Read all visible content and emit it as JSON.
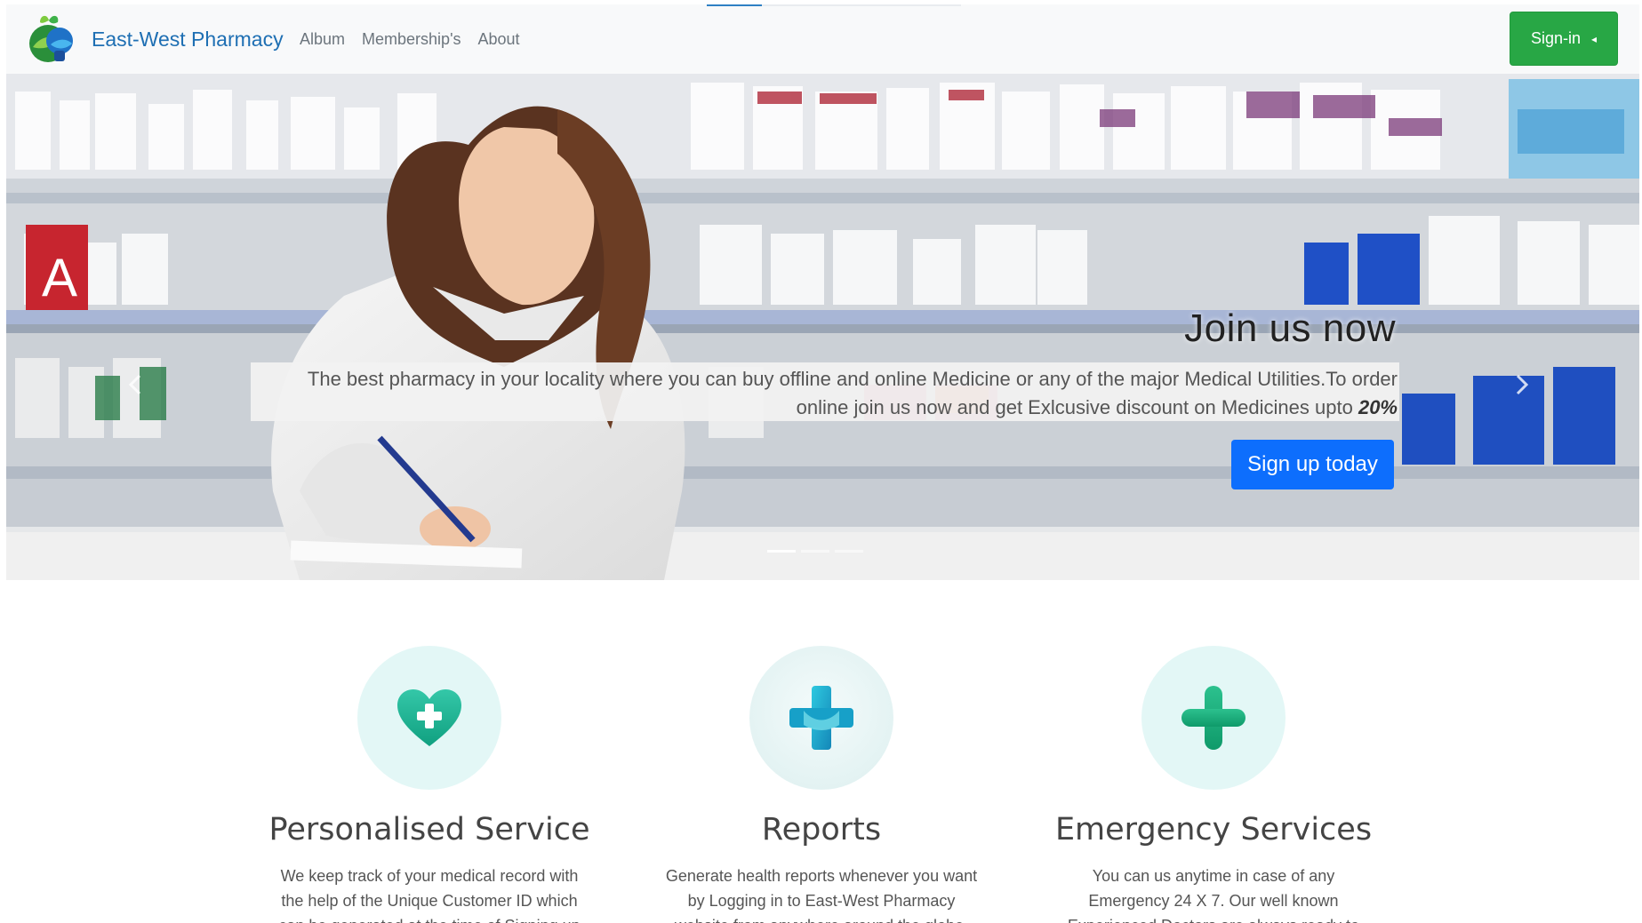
{
  "navbar": {
    "brand_name": "East-West Pharmacy",
    "links": [
      "Album",
      "Membership's",
      "About"
    ],
    "signin_label": "Sign-in",
    "signin_caret": "◂",
    "signin_color": "#28a745"
  },
  "hero": {
    "title": "Join us now",
    "description": "The best pharmacy in your locality where you can buy offline and online Medicine or any of the major Medical Utilities.To order online join us now and get Exlcusive discount on Medicines upto",
    "discount": "20%",
    "signup_label": "Sign up today",
    "signup_color": "#0d6efd",
    "prev_icon": "chevron-left-icon",
    "next_icon": "chevron-right-icon"
  },
  "features": [
    {
      "icon": "heart-plus-icon",
      "title": "Personalised Service",
      "text": "We keep track of your medical record with the help of the Unique Customer ID which can be generated at the time of Signing up and joining East-West Pharmacy."
    },
    {
      "icon": "medical-cross-icon",
      "title": "Reports",
      "text": "Generate health reports whenever you want by Logging in to East-West Pharmacy website from anywhere around the globe."
    },
    {
      "icon": "plus-icon",
      "title": "Emergency Services",
      "text": "You can us anytime in case of any Emergency 24 X 7. Our well known Experienced Doctors are always ready to offer their service."
    }
  ]
}
